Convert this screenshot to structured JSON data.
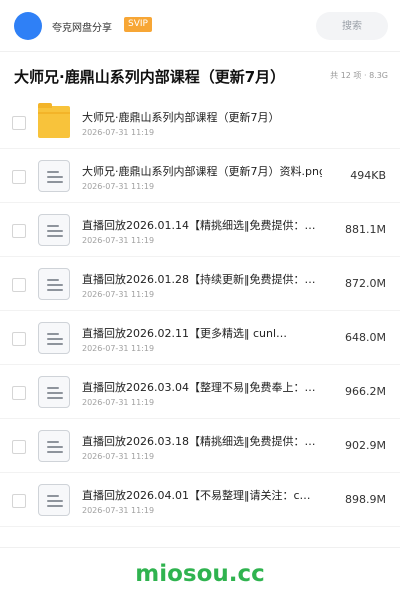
{
  "header": {
    "app_name": "夸克网盘分享",
    "badge": "SVIP",
    "search_placeholder": "搜索"
  },
  "share": {
    "title": "大师兄·鹿鼎山系列内部课程（更新7月）",
    "meta": "共 12 项 · 8.3G"
  },
  "files": [
    {
      "type": "folder",
      "name": "大师兄·鹿鼎山系列内部课程（更新7月）",
      "date": "2026-07-31 11:19",
      "size": ""
    },
    {
      "type": "file",
      "name": "大师兄·鹿鼎山系列内部课程（更新7月）资料.png",
      "date": "2026-07-31 11:19",
      "size": "494KB"
    },
    {
      "type": "file",
      "name": "直播回放2026.01.14【精挑细选‖免费提供：…",
      "date": "2026-07-31 11:19",
      "size": "881.1M"
    },
    {
      "type": "file",
      "name": "直播回放2026.01.28【持续更新‖免费提供：…",
      "date": "2026-07-31 11:19",
      "size": "872.0M"
    },
    {
      "type": "file",
      "name": "直播回放2026.02.11【更多精选‖ cunl…",
      "date": "2026-07-31 11:19",
      "size": "648.0M"
    },
    {
      "type": "file",
      "name": "直播回放2026.03.04【整理不易‖免费奉上：…",
      "date": "2026-07-31 11:19",
      "size": "966.2M"
    },
    {
      "type": "file",
      "name": "直播回放2026.03.18【精挑细选‖免费提供：…",
      "date": "2026-07-31 11:19",
      "size": "902.9M"
    },
    {
      "type": "file",
      "name": "直播回放2026.04.01【不易整理‖请关注：c…",
      "date": "2026-07-31 11:19",
      "size": "898.9M"
    }
  ],
  "footer": {
    "watermark": "miosou.cc"
  },
  "colors": {
    "accent": "#2f80f6",
    "badge": "#f7a635",
    "folder": "#f8c33b",
    "watermark": "#2fb34f"
  }
}
